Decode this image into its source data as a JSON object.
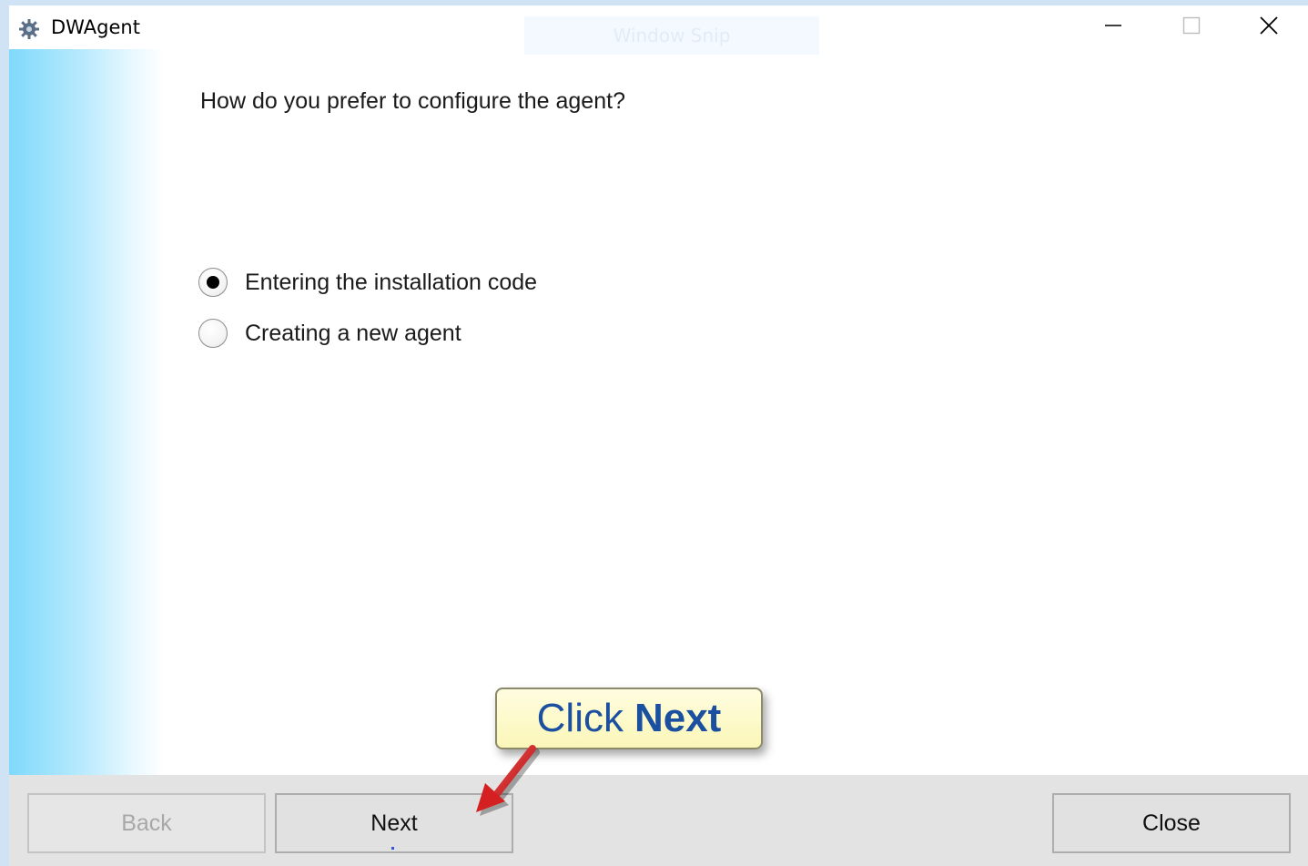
{
  "window": {
    "title": "DWAgent",
    "overlay_label": "Window Snip",
    "app_icon": "gear-icon",
    "controls": {
      "minimize_icon": "minimize-icon",
      "maximize_icon": "maximize-icon",
      "close_icon": "close-icon"
    }
  },
  "main": {
    "question": "How do you prefer to configure the agent?",
    "options": [
      {
        "label": "Entering the installation code",
        "selected": true
      },
      {
        "label": "Creating a new agent",
        "selected": false
      }
    ]
  },
  "footer": {
    "back_label": "Back",
    "next_label": "Next",
    "close_label": "Close"
  },
  "annotation": {
    "prefix": "Click",
    "emphasis": "Next",
    "arrow_color": "#d42020",
    "text_color": "#1b4fa0"
  },
  "colors": {
    "sidebar_gradient_start": "#7fd9fb",
    "footer_bg": "#e3e3e3",
    "callout_bg": "#fbf6b8"
  }
}
